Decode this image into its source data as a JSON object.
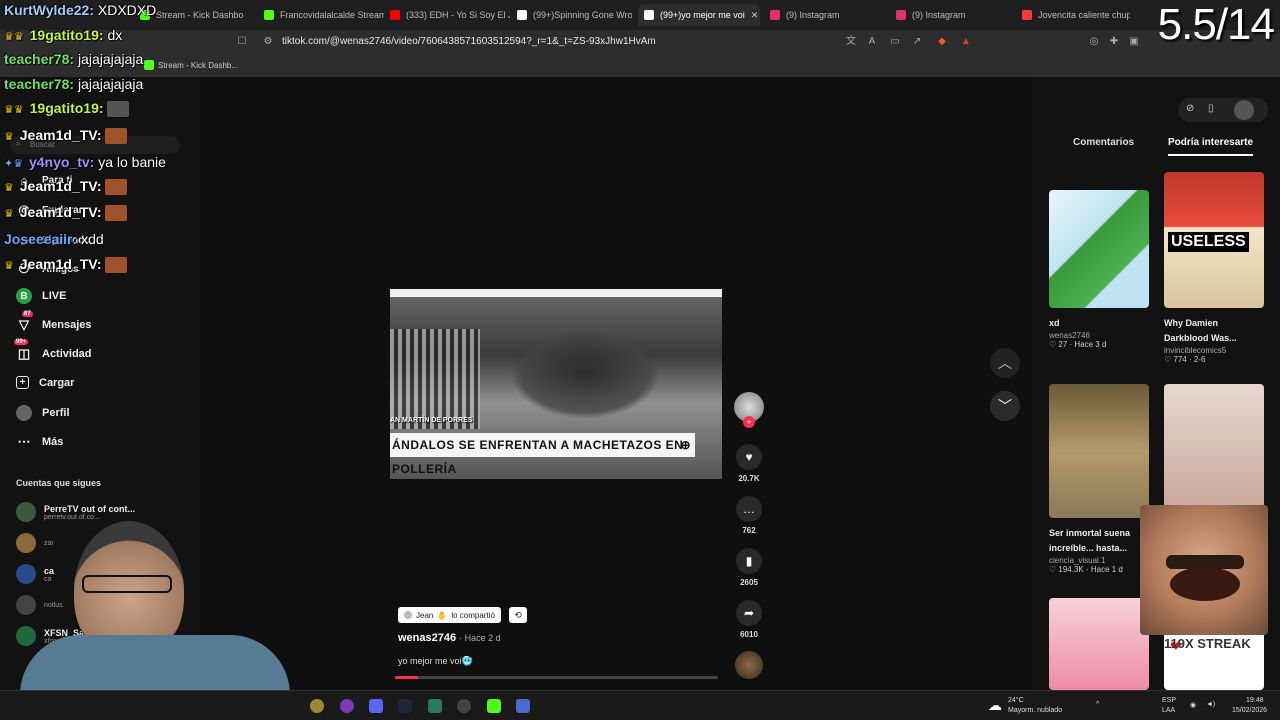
{
  "browser": {
    "tabs": [
      {
        "label": "Stream - Kick Dashbo",
        "color": "#53fc18"
      },
      {
        "label": "Francovidalalcalde Stream",
        "color": "#53fc18"
      },
      {
        "label": "(333) EDH - Yo Si Soy El Ju",
        "color": "#ff0000"
      },
      {
        "label": "(99+)Spinning Gone Wron",
        "color": "#ffffff"
      },
      {
        "label": "(99+)yo mejor me voi",
        "color": "#ffffff"
      },
      {
        "label": "(9) Instagram",
        "color": "#e1306c"
      },
      {
        "label": "(9) Instagram",
        "color": "#e1306c"
      },
      {
        "label": "Jovencita caliente chupa y",
        "color": "#ff3b3b"
      }
    ],
    "url": "tiktok.com/@wenas2746/video/7606438571603512594?_r=1&_t=ZS-93xJhw1HvAm",
    "bookmark": "Stream - Kick Dashb..."
  },
  "counter": "5.5/14",
  "chat": [
    {
      "user": "KurtWylde22:",
      "msg": "XDXDXD",
      "color": "#9ad0ff"
    },
    {
      "user": "19gatito19:",
      "msg": "dx",
      "color": "#c2f542"
    },
    {
      "user": "teacher78:",
      "msg": "jajajajajaja",
      "color": "#69e36a"
    },
    {
      "user": "teacher78:",
      "msg": "jajajajajaja",
      "color": "#69e36a"
    },
    {
      "user": "19gatito19:",
      "msg": "",
      "color": "#c2f542"
    },
    {
      "user": "Jeam1d_TV:",
      "msg": "",
      "color": "#ffffff"
    },
    {
      "user": "y4nyo_tv:",
      "msg": "ya lo banie",
      "color": "#a78bfa"
    },
    {
      "user": "Jeam1d_TV:",
      "msg": "",
      "color": "#ffffff"
    },
    {
      "user": "Jeam1d_TV:",
      "msg": "",
      "color": "#ffffff"
    },
    {
      "user": "Joseeeaiir:",
      "msg": "xdd",
      "color": "#6aa6ff"
    },
    {
      "user": "Jeam1d_TV:",
      "msg": "",
      "color": "#ffffff"
    }
  ],
  "sidebar": {
    "search_placeholder": "Buscar",
    "items": [
      {
        "label": "Para ti",
        "icon": "home-icon"
      },
      {
        "label": "Explorar",
        "icon": "compass-icon"
      },
      {
        "label": "Siguiendo",
        "icon": "following-icon"
      },
      {
        "label": "Amigos",
        "icon": "friends-icon"
      },
      {
        "label": "LIVE",
        "icon": "live-icon"
      },
      {
        "label": "Mensajes",
        "icon": "message-icon",
        "badge": "87"
      },
      {
        "label": "Actividad",
        "icon": "activity-icon",
        "badge": "99+"
      },
      {
        "label": "Cargar",
        "icon": "upload-icon"
      },
      {
        "label": "Perfil",
        "icon": "profile-icon"
      },
      {
        "label": "Más",
        "icon": "more-icon"
      }
    ],
    "following_title": "Cuentas que sigues",
    "following": [
      {
        "name": "PerreTV out of cont...",
        "handle": "perretv.out.of.co..."
      },
      {
        "name": "",
        "handle": "zar"
      },
      {
        "name": "ca",
        "handle": "ca"
      },
      {
        "name": "",
        "handle": "notlus"
      },
      {
        "name": "XFSN_Sa",
        "handle": "xfsn_sabe"
      }
    ]
  },
  "video": {
    "caption": "ÁNDALOS SE ENFRENTAN A MACHETAZOS EN POLLERÍA",
    "caption_prefix": "AN MARTÍN DE PORRES",
    "shared_by": "Jean",
    "shared_text": "lo compartió",
    "author": "wenas2746",
    "time": "· Hace 2 d",
    "description": "yo mejor me voi🥶",
    "progress": 0.07
  },
  "actions": [
    {
      "name": "like",
      "icon": "heart-icon",
      "count": "20.7K",
      "glyph": "♥"
    },
    {
      "name": "comment",
      "icon": "comment-icon",
      "count": "762",
      "glyph": "…"
    },
    {
      "name": "save",
      "icon": "bookmark-icon",
      "count": "2605",
      "glyph": "▮"
    },
    {
      "name": "share",
      "icon": "share-icon",
      "count": "6010",
      "glyph": "➦"
    }
  ],
  "rightpanel": {
    "tabs": [
      "Comentarios",
      "Podría interesarte"
    ],
    "cards": [
      {
        "title": "xd",
        "user": "wenas2746",
        "stats": "♡ 27 · Hace 3 d"
      },
      {
        "title": "Why Damien Darkblood Was...",
        "user": "invinciblecomics5",
        "stats": "♡ 774 · 2-6",
        "thumb_text": "USELESS"
      },
      {
        "title": "Ser inmortal suena increíble... hasta...",
        "user": "ciencia_visual.1",
        "stats": "♡ 194.3K · Hace 1 d"
      },
      {
        "title": "",
        "user": "",
        "stats": ""
      },
      {
        "title": "",
        "user": "",
        "stats": ""
      },
      {
        "title": "",
        "user": "",
        "stats": "",
        "thumb_text": "119X STREAK"
      }
    ]
  },
  "taskbar": {
    "weather_temp": "24°C",
    "weather_desc": "Mayorm. nublado",
    "lang": "ESP",
    "lang_sub": "LAA",
    "time": "19:48",
    "date": "15/02/2026"
  }
}
